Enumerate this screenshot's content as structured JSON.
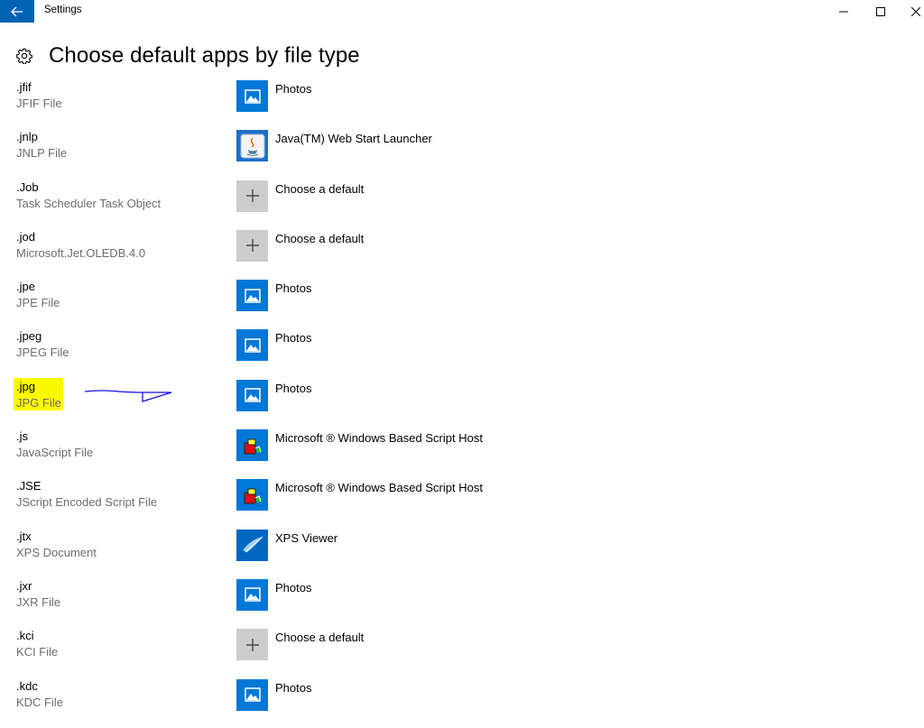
{
  "window": {
    "title": "Settings"
  },
  "header": {
    "title": "Choose default apps by file type"
  },
  "colors": {
    "accent": "#0078d7",
    "highlight": "#fbf900",
    "annotation": "#0000ff"
  },
  "file_types": [
    {
      "ext": ".jfif",
      "desc": "JFIF File",
      "app": "Photos",
      "icon": "photos-icon"
    },
    {
      "ext": ".jnlp",
      "desc": "JNLP File",
      "app": "Java(TM) Web Start Launcher",
      "icon": "java-icon"
    },
    {
      "ext": ".Job",
      "desc": "Task Scheduler Task Object",
      "app": "Choose a default",
      "icon": "plus-icon"
    },
    {
      "ext": ".jod",
      "desc": "Microsoft.Jet.OLEDB.4.0",
      "app": "Choose a default",
      "icon": "plus-icon"
    },
    {
      "ext": ".jpe",
      "desc": "JPE File",
      "app": "Photos",
      "icon": "photos-icon"
    },
    {
      "ext": ".jpeg",
      "desc": "JPEG File",
      "app": "Photos",
      "icon": "photos-icon"
    },
    {
      "ext": ".jpg",
      "desc": "JPG File",
      "app": "Photos",
      "icon": "photos-icon",
      "highlighted": true
    },
    {
      "ext": ".js",
      "desc": "JavaScript File",
      "app": "Microsoft ® Windows Based Script Host",
      "icon": "script-host-icon"
    },
    {
      "ext": ".JSE",
      "desc": "JScript Encoded Script File",
      "app": "Microsoft ® Windows Based Script Host",
      "icon": "script-host-icon"
    },
    {
      "ext": ".jtx",
      "desc": "XPS Document",
      "app": "XPS Viewer",
      "icon": "xps-viewer-icon"
    },
    {
      "ext": ".jxr",
      "desc": "JXR File",
      "app": "Photos",
      "icon": "photos-icon"
    },
    {
      "ext": ".kci",
      "desc": "KCI File",
      "app": "Choose a default",
      "icon": "plus-icon"
    },
    {
      "ext": ".kdc",
      "desc": "KDC File",
      "app": "Photos",
      "icon": "photos-icon"
    }
  ]
}
